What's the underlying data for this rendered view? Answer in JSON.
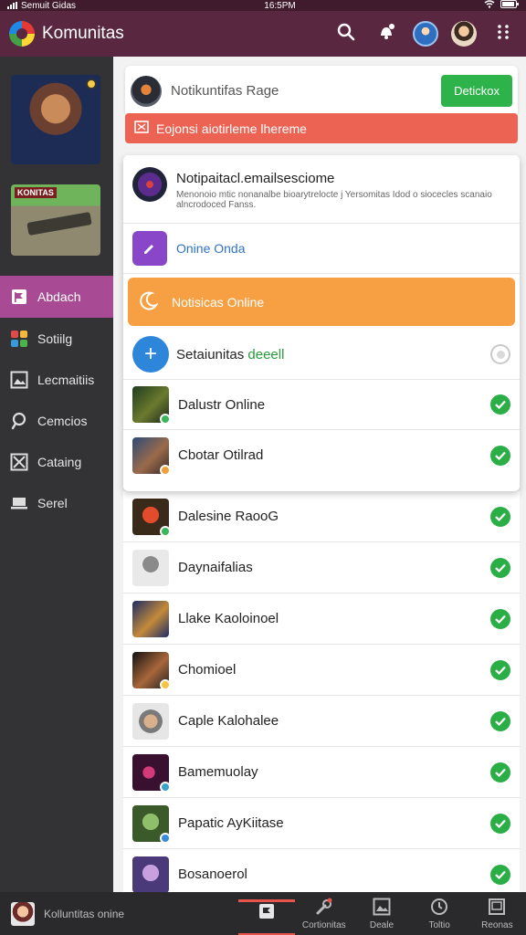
{
  "status": {
    "carrier": "Semuit Gidas",
    "time": "16:5PM"
  },
  "app": {
    "title": "Komunitas"
  },
  "sidebar": {
    "promo_tag": "KONITAS",
    "items": [
      {
        "label": "Abdach",
        "icon": "flag-icon",
        "active": true
      },
      {
        "label": "Sotiilg",
        "icon": "app-grid-icon",
        "active": false
      },
      {
        "label": "Lecmaitiis",
        "icon": "image-box-icon",
        "active": false
      },
      {
        "label": "Cemcios",
        "icon": "pin-icon",
        "active": false
      },
      {
        "label": "Cataing",
        "icon": "crossed-box-icon",
        "active": false
      },
      {
        "label": "Serel",
        "icon": "laptop-icon",
        "active": false
      }
    ]
  },
  "notification": {
    "title": "Notikuntifas Rage",
    "button": "Detickox",
    "alert": "Eojonsi aiotirleme lhereme"
  },
  "panel": {
    "title": "Notipaitacl.emailsesciome",
    "subtitle": "Menonoio mtic nonanalbe bioarytrelocte j Yersomitas Idod o siocecles scanaio alncrodoced Fanss.",
    "row1": "Onine Onda",
    "orange": "Notisicas Online",
    "row3_a": "Setaiunitas ",
    "row3_b": "deeell",
    "row4": "Dalustr Online",
    "row5": "Cbotar Otilrad"
  },
  "list": [
    {
      "name": "Dalesine RaooG"
    },
    {
      "name": "Daynaifalias"
    },
    {
      "name": "Llake Kaoloinoel"
    },
    {
      "name": "Chomioel"
    },
    {
      "name": "Caple Kalohalee"
    },
    {
      "name": "Bamemuolay"
    },
    {
      "name": "Papatic AyKiitase"
    },
    {
      "name": "Bosanoerol"
    }
  ],
  "bottom": {
    "user_label": "Kolluntitas onine",
    "tabs": [
      {
        "label": "",
        "icon": "flag-icon",
        "active": true
      },
      {
        "label": "Cortionitas",
        "icon": "wrench-icon",
        "active": false
      },
      {
        "label": "Deale",
        "icon": "image-box-icon",
        "active": false
      },
      {
        "label": "Toltio",
        "icon": "clock-icon",
        "active": false
      },
      {
        "label": "Reonas",
        "icon": "window-icon",
        "active": false
      }
    ]
  },
  "colors": {
    "app_bar": "#5a2740",
    "sidebar": "#333336",
    "active_item": "#a84a94",
    "green": "#2eb34b",
    "alert": "#ec6353",
    "orange": "#f6a043",
    "blue": "#2d86d9",
    "purple": "#8a46c9"
  }
}
